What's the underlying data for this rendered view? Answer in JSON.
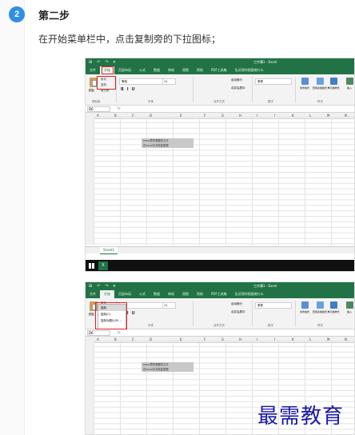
{
  "step": {
    "number": "2",
    "title": "第二步",
    "description": "在开始菜单栏中，点击复制旁的下拉图标；"
  },
  "excel": {
    "window_title": "工作簿1 - Excel",
    "tabs": [
      "文件",
      "开始",
      "页面布局",
      "公式",
      "数据",
      "审阅",
      "视图",
      "帮助",
      "PDF工具集",
      "告诉我你想要做什么"
    ],
    "active_tab": "开始",
    "paste_label": "粘贴",
    "clipboard_items": [
      "剪切",
      "复制",
      "格式刷"
    ],
    "font_name": "等线",
    "font_size": "11",
    "number_format": "常规",
    "wrap_text": "自动换行",
    "merge_center": "合并后居中",
    "styles_buttons": [
      "条件格式",
      "套用表格格式",
      "单元格样式"
    ],
    "insert_label": "插入",
    "group_labels": [
      "剪贴板",
      "字体",
      "对齐方式",
      "数字",
      "样式"
    ],
    "name_box": "D6",
    "fx": "fx",
    "columns": [
      "A",
      "B",
      "C",
      "D",
      "E",
      "F",
      "G",
      "H",
      "I",
      "J",
      "K",
      "L",
      "M",
      "N"
    ],
    "cell_text": [
      "excel表所需要的文字",
      "在excel中并粘贴数据"
    ],
    "sheet_tab": "Sheet1",
    "copy_dropdown": [
      "复制",
      "复制(C)",
      "复制为图片(P)..."
    ],
    "colors": {
      "excel_green": "#217346",
      "highlight_red": "#e02020",
      "badge_blue": "#2f8ee5"
    }
  },
  "watermark": "最需教育"
}
